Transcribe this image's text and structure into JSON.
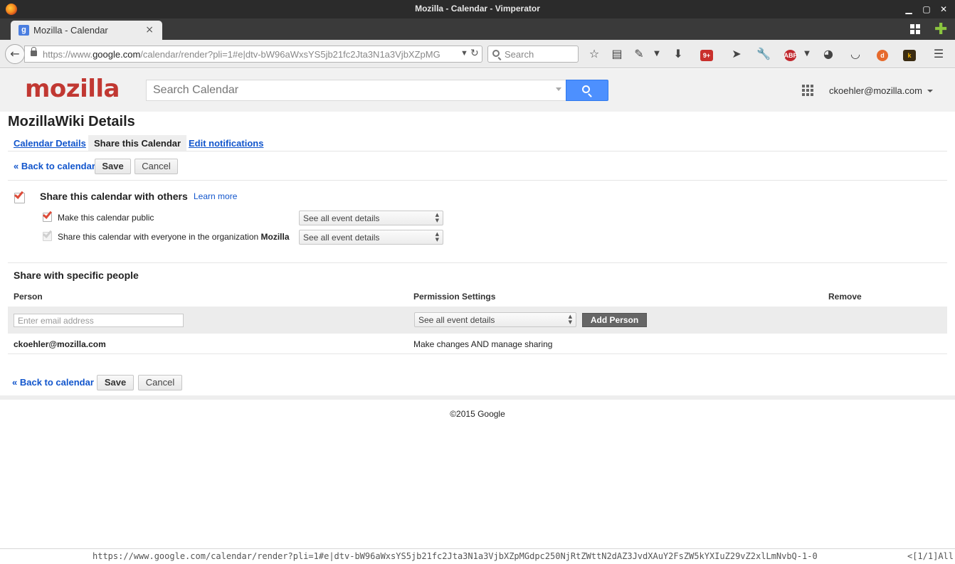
{
  "window": {
    "title": "Mozilla - Calendar - Vimperator"
  },
  "tab": {
    "label": "Mozilla - Calendar",
    "close": "×",
    "favicon": "g"
  },
  "nav": {
    "url_prefix": "https://www.",
    "url_host": "google.com",
    "url_rest": "/calendar/render?pli=1#e|dtv-bW96aWxsYS5jb21fc2Jta3N1a3VjbXZpMG",
    "search_placeholder": "Search"
  },
  "header": {
    "logo": "mozilla",
    "search_placeholder": "Search Calendar",
    "account": "ckoehler@mozilla.com"
  },
  "page": {
    "title": "MozillaWiki Details",
    "tabs": [
      "Calendar Details",
      "Share this Calendar",
      "Edit notifications"
    ],
    "back_link": "« Back to calendar",
    "save": "Save",
    "cancel": "Cancel"
  },
  "sharing": {
    "heading": "Share this calendar with others",
    "learn_more": "Learn more",
    "public_label": "Make this calendar public",
    "public_checked": true,
    "org_label": "Share this calendar with everyone in the organization",
    "org_name": "Mozilla",
    "org_checked": true,
    "public_select": "See all event details",
    "org_select": "See all event details"
  },
  "specific": {
    "heading": "Share with specific people",
    "col_person": "Person",
    "col_permission": "Permission Settings",
    "col_remove": "Remove",
    "email_placeholder": "Enter email address",
    "permission_select": "See all event details",
    "add_button": "Add Person",
    "people": [
      {
        "email": "ckoehler@mozilla.com",
        "permission": "Make changes AND manage sharing"
      }
    ]
  },
  "footer": {
    "copyright": "©2015 Google"
  },
  "status": {
    "url": "https://www.google.com/calendar/render?pli=1#e|dtv-bW96aWxsYS5jb21fc2Jta3N1a3VjbXZpMGdpc250NjRtZWttN2dAZ3JvdXAuY2FsZW5kYXIuZ29vZ2xlLmNvbQ-1-0",
    "position": "<[1/1]All"
  },
  "colors": {
    "link": "#1155cc",
    "logo": "#c13832",
    "search_button": "#4d90fe",
    "checkmark": "#dd4b39"
  }
}
